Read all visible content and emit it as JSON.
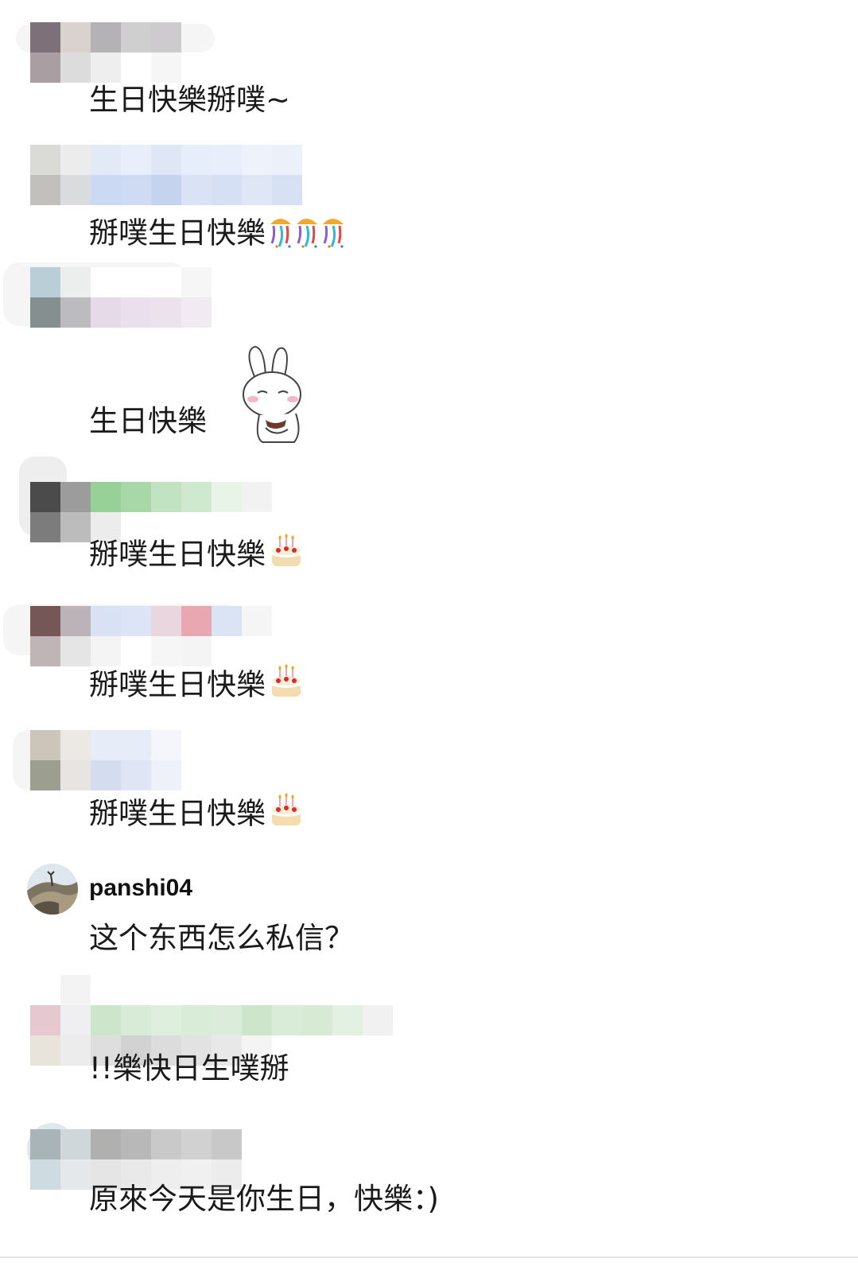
{
  "comments": [
    {
      "author": "",
      "text": "生日快樂掰噗~",
      "emoji": "",
      "blurred": true,
      "palette": [
        "#7d7078",
        "#d9d2cf",
        "#b4b2b4",
        "#cfcfcf",
        "#cdcbcd",
        "#a99fa3",
        "#dcdcdc",
        "#eeeeee",
        "#ffffff",
        "#f6f6f6"
      ]
    },
    {
      "author": "",
      "text": "掰噗生日快樂",
      "emoji": "party-popper x3",
      "blurred": true,
      "palette": [
        "#dadad6",
        "#ececec",
        "#e3eaf7",
        "#e9effa",
        "#dfe6f6",
        "#e7eefb",
        "#e8effb",
        "#eef2fb",
        "#ecf0fa",
        "#c1c0bd",
        "#d9dbdd",
        "#cbd9f2",
        "#cedbf3",
        "#c5d3ef",
        "#d9e3f5",
        "#d6e0f4",
        "#dfe6f6",
        "#d6e1f4"
      ]
    },
    {
      "author": "",
      "text": "生日快樂",
      "emoji": "",
      "sticker": "bunny-sticker",
      "blurred": true,
      "palette": [
        "#b9ced6",
        "#eceeed",
        "#ffffff",
        "#ffffff",
        "#ffffff",
        "#f6f6f6",
        "#858f8f",
        "#bcbcbe",
        "#e6d9e8",
        "#eadfec",
        "#ebe2ee",
        "#f1eaf3"
      ]
    },
    {
      "author": "",
      "text": "掰噗生日快樂",
      "emoji": "birthday-cake",
      "blurred": true,
      "palette": [
        "#4b4b4b",
        "#9c9c9c",
        "#98d197",
        "#a8d8a7",
        "#c2e3c1",
        "#cfe9cf",
        "#e9f4e8",
        "#f2f2f2",
        "#7c7c7c",
        "#bcbcbc",
        "#ececec",
        "#ffffff",
        "#ffffff",
        "#ffffff",
        "#ffffff",
        "#ffffff"
      ]
    },
    {
      "author": "",
      "text": "掰噗生日快樂",
      "emoji": "birthday-cake",
      "blurred": true,
      "palette": [
        "#755757",
        "#bbb3b7",
        "#d8e2f4",
        "#dce4f5",
        "#e9d6df",
        "#e9a8b1",
        "#dbe4f5",
        "#f5f5f5",
        "#bfb4b6",
        "#e5e5e5",
        "#f4f4f4",
        "#ffffff",
        "#f6f6f6",
        "#f4f4f4",
        "#ffffff",
        "#ffffff"
      ]
    },
    {
      "author": "",
      "text": "掰噗生日快樂",
      "emoji": "birthday-cake",
      "blurred": true,
      "palette": [
        "#cbc6b9",
        "#ece9e5",
        "#e7edf8",
        "#e6ecf8",
        "#f4f6fb",
        "#9c9f8f",
        "#e7e4e2",
        "#d4dcef",
        "#dfe5f5",
        "#eef1f8"
      ]
    },
    {
      "author": "panshi04",
      "text": "这个东西怎么私信？",
      "emoji": "",
      "blurred": false,
      "palette": []
    },
    {
      "author": "",
      "text": "!!樂快日生噗掰",
      "emoji": "",
      "blurred": true,
      "palette": [
        "#ffffff",
        "#f3f3f3",
        "#ffffff",
        "#ffffff",
        "#ffffff",
        "#ffffff",
        "#ffffff",
        "#ffffff",
        "#ffffff",
        "#ffffff",
        "#ffffff",
        "#ffffff",
        "#e6c8d0",
        "#efeff1",
        "#cde5cb",
        "#d7ebd6",
        "#dfefde",
        "#d9ecd8",
        "#dcecdb",
        "#cde6cb",
        "#d9ecd8",
        "#d6ead4",
        "#e3f1e2",
        "#f1f1f1",
        "#e8e4dc",
        "#ececec",
        "#dedede",
        "#d2d2d2",
        "#dcdcdc",
        "#e2e2e2",
        "#e8e8e8",
        "#f4f4f4",
        "#ffffff",
        "#ffffff",
        "#ffffff",
        "#ffffff"
      ]
    },
    {
      "author": "",
      "text": "原來今天是你生日，快樂：)",
      "emoji": "",
      "blurred": true,
      "palette": [
        "#a9b4b9",
        "#cfd7da",
        "#b0b0b0",
        "#b8b8b8",
        "#c9c9c9",
        "#d1d1d1",
        "#c8c8c8",
        "#cedbe0",
        "#e4e8ea",
        "#e5e5e5",
        "#e9e9e9",
        "#eeeeee",
        "#f0f0f0",
        "#ececec"
      ]
    }
  ]
}
